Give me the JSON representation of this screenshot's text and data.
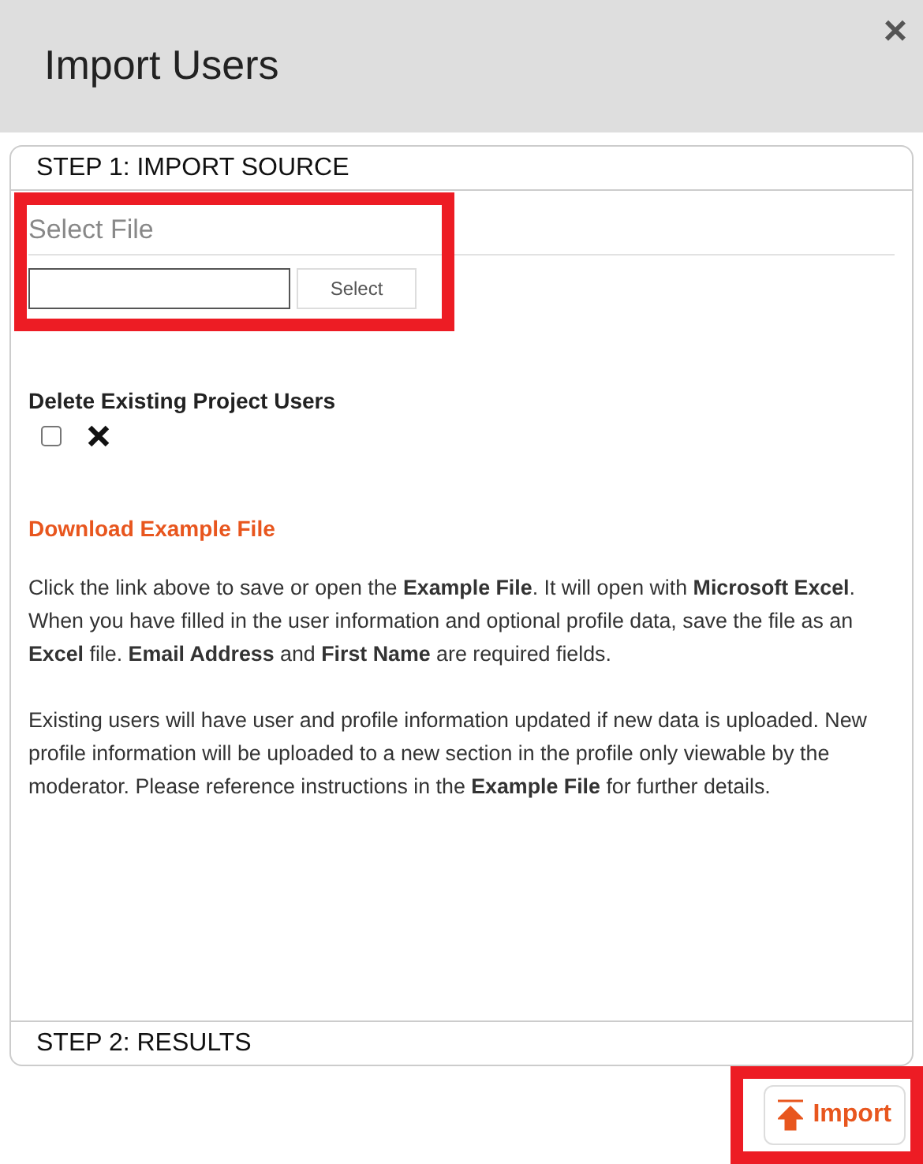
{
  "dialog": {
    "title": "Import Users",
    "close": "×"
  },
  "steps": [
    {
      "label": "STEP 1: IMPORT SOURCE"
    },
    {
      "label": "STEP 2: RESULTS"
    }
  ],
  "file_section": {
    "heading": "Select File",
    "button": "Select",
    "highlighted": true
  },
  "delete_option": {
    "label": "Delete Existing Project Users",
    "checked": false
  },
  "download_link": "Download Example File",
  "paragraphs": [
    "Click the link above to save or open the **Example File**. It will open with **Microsoft Excel**. When you have filled in the user information and optional profile data, save the file as an **Excel** file.  **Email Address** and **First Name** are required fields.",
    "Existing users will have user and profile information updated if new data is uploaded. New profile information will be uploaded to a new section in the profile only viewable by the moderator. Please reference instructions in the **Example File** for further details."
  ],
  "import_button": {
    "label": "Import",
    "highlighted": true
  }
}
